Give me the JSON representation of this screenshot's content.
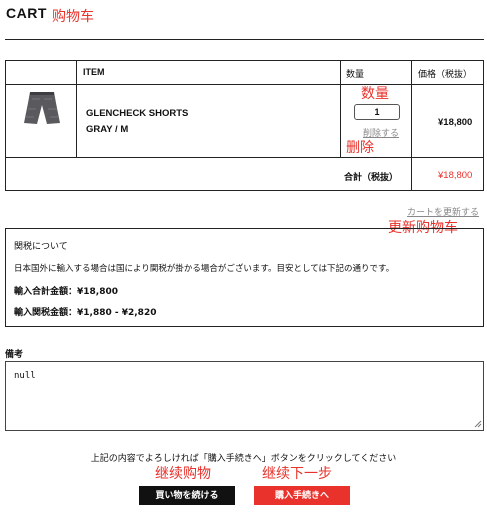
{
  "header": {
    "title": "CART",
    "annotation": "购物车"
  },
  "table": {
    "columns": {
      "item": "ITEM",
      "quantity": "数量",
      "price": "価格（税抜）"
    },
    "rows": [
      {
        "name": "GLENCHECK SHORTS",
        "variant": "GRAY / M",
        "quantity": "1",
        "delete_label": "削除する",
        "price": "¥18,800",
        "annotations": {
          "quantity": "数量",
          "delete": "删除"
        }
      }
    ],
    "subtotal_label": "合計（税抜）",
    "subtotal_value": "¥18,800"
  },
  "update_cart": {
    "label": "カートを更新する",
    "annotation": "更新购物车"
  },
  "duty": {
    "title": "関税について",
    "description": "日本国外に輸入する場合は国により関税が掛かる場合がございます。目安としては下記の通りです。",
    "import_total": "輸入合計金額：¥18,800",
    "import_duty": "輸入関税金額：¥1,880 - ¥2,820"
  },
  "notes": {
    "label": "備考",
    "value": "null"
  },
  "footer": {
    "instruction": "上記の内容でよろしければ「購入手続きへ」ボタンをクリックしてください",
    "continue_label": "買い物を続ける",
    "continue_annotation": "继续购物",
    "checkout_label": "購入手続きへ",
    "checkout_annotation": "继续下一步"
  },
  "colors": {
    "accent": "#e8322b",
    "text": "#111111",
    "muted": "#888888"
  }
}
